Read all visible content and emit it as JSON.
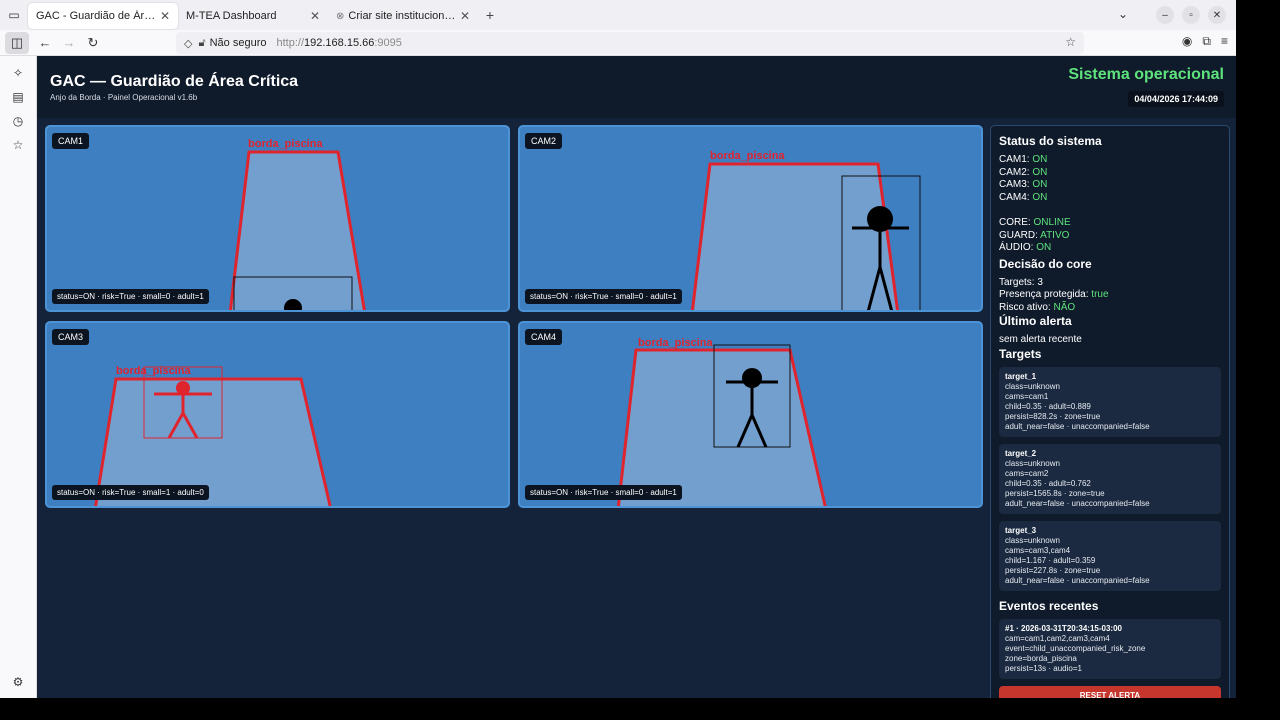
{
  "browser": {
    "tabs": [
      {
        "label": "GAC - Guardião de Área Crítica",
        "active": true
      },
      {
        "label": "M-TEA Dashboard",
        "active": false
      },
      {
        "label": "Criar site institucional M-TEA",
        "active": false
      }
    ],
    "url_insecure_label": "Não seguro",
    "url_prefix": "http://",
    "url_host": "192.168.15.66",
    "url_port": ":9095"
  },
  "header": {
    "title": "GAC — Guardião de Área Crítica",
    "subtitle": "Anjo da Borda · Painel Operacional v1.6b",
    "system_status": "Sistema operacional",
    "datetime": "04/04/2026 17:44:09"
  },
  "cameras": [
    {
      "label": "CAM1",
      "zone_label": "borda_piscina",
      "status": "status=ON · risk=True · small=0 · adult=1"
    },
    {
      "label": "CAM2",
      "zone_label": "borda_piscina",
      "status": "status=ON · risk=True · small=0 · adult=1"
    },
    {
      "label": "CAM3",
      "zone_label": "borda_piscina",
      "status": "status=ON · risk=True · small=1 · adult=0"
    },
    {
      "label": "CAM4",
      "zone_label": "borda_piscina",
      "status": "status=ON · risk=True · small=0 · adult=1"
    }
  ],
  "panel": {
    "status_title": "Status do sistema",
    "cams": [
      {
        "name": "CAM1:",
        "value": "ON"
      },
      {
        "name": "CAM2:",
        "value": "ON"
      },
      {
        "name": "CAM3:",
        "value": "ON"
      },
      {
        "name": "CAM4:",
        "value": "ON"
      }
    ],
    "core": {
      "name": "CORE:",
      "value": "ONLINE"
    },
    "guard": {
      "name": "GUARD:",
      "value": "ATIVO"
    },
    "audio": {
      "name": "ÁUDIO:",
      "value": "ON"
    },
    "decision_title": "Decisão do core",
    "targets_line": "Targets: 3",
    "presence": {
      "name": "Presença protegida:",
      "value": "true"
    },
    "risk": {
      "name": "Risco ativo:",
      "value": "NÃO"
    },
    "last_alert_title": "Último alerta",
    "last_alert": "sem alerta recente",
    "targets_title": "Targets",
    "targets": [
      {
        "id": "target_1",
        "class": "class=unknown",
        "cams": "cams=cam1",
        "scores": "child=0.35 · adult=0.889",
        "persist": "persist=828.2s · zone=true",
        "flags": "adult_near=false · unaccompanied=false"
      },
      {
        "id": "target_2",
        "class": "class=unknown",
        "cams": "cams=cam2",
        "scores": "child=0.35 · adult=0.762",
        "persist": "persist=1565.8s · zone=true",
        "flags": "adult_near=false · unaccompanied=false"
      },
      {
        "id": "target_3",
        "class": "class=unknown",
        "cams": "cams=cam3,cam4",
        "scores": "child=1.167 · adult=0.359",
        "persist": "persist=227.8s · zone=true",
        "flags": "adult_near=false · unaccompanied=false"
      }
    ],
    "events_title": "Eventos recentes",
    "events": [
      {
        "head": "#1 · 2026-03-31T20:34:15-03:00",
        "cams": "cam=cam1,cam2,cam3,cam4",
        "event": "event=child_unaccompanied_risk_zone",
        "zone": "zone=borda_piscina",
        "persist": "persist=13s · audio=1"
      }
    ],
    "reset_label": "RESET ALERTA"
  },
  "colors": {
    "ok": "#5ee37c",
    "zone": "#e0242e",
    "reset": "#c6362d"
  }
}
